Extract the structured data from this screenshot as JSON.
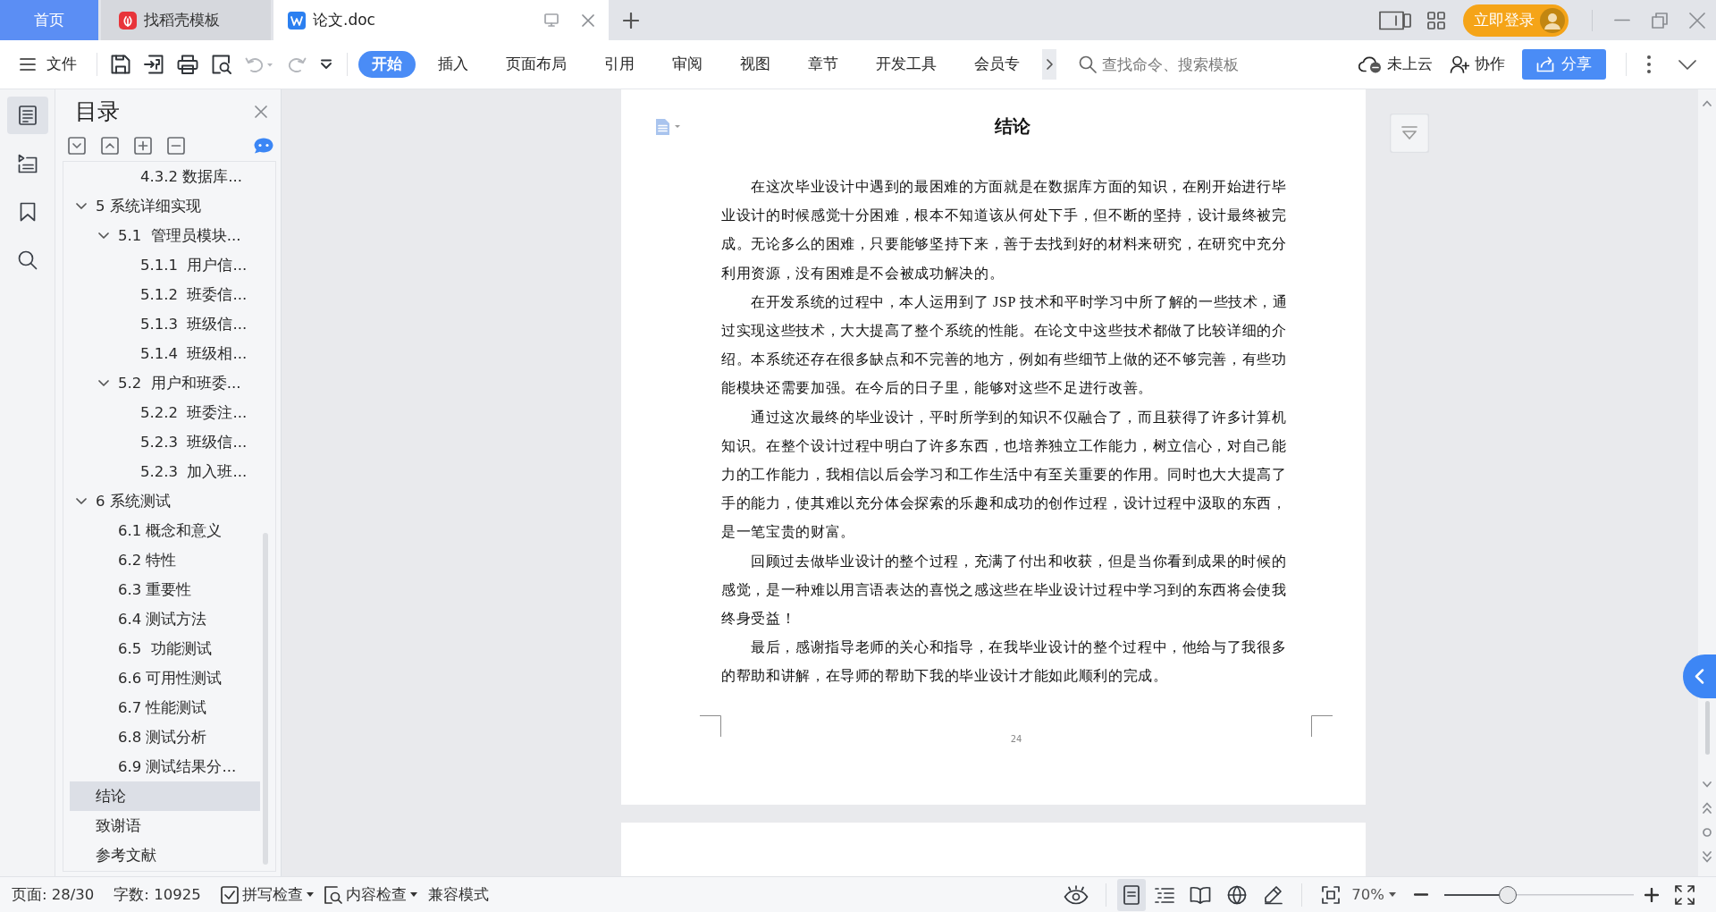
{
  "title_bar": {
    "tabs": [
      {
        "kind": "home",
        "label": "首页",
        "selected": false
      },
      {
        "kind": "template",
        "label": "找稻壳模板",
        "selected": false
      },
      {
        "kind": "document",
        "label": "论文.doc",
        "selected": true
      }
    ],
    "login_button": "立即登录"
  },
  "ribbon": {
    "file_menu": "文件",
    "quick_access": [
      {
        "kind": "save",
        "disabled": false
      },
      {
        "kind": "export",
        "disabled": false
      },
      {
        "kind": "print",
        "disabled": false
      },
      {
        "kind": "preview",
        "disabled": false
      },
      {
        "kind": "undo",
        "disabled": true
      },
      {
        "kind": "redo",
        "disabled": true
      },
      {
        "kind": "customize",
        "disabled": false
      }
    ],
    "tabs": [
      {
        "label": "开始",
        "selected": true
      },
      {
        "label": "插入",
        "selected": false
      },
      {
        "label": "页面布局",
        "selected": false
      },
      {
        "label": "引用",
        "selected": false
      },
      {
        "label": "审阅",
        "selected": false
      },
      {
        "label": "视图",
        "selected": false
      },
      {
        "label": "章节",
        "selected": false
      },
      {
        "label": "开发工具",
        "selected": false
      },
      {
        "label": "会员专",
        "selected": false
      }
    ],
    "search": {
      "placeholder": "查找命令、搜索模板"
    },
    "cloud_status": "未上云",
    "collaborate": "协作",
    "share": "分享"
  },
  "side_rail": [
    {
      "kind": "outline",
      "selected": true
    },
    {
      "kind": "navigation",
      "selected": false
    },
    {
      "kind": "bookmark",
      "selected": false
    },
    {
      "kind": "search",
      "selected": false
    }
  ],
  "sidebar": {
    "title": "目录",
    "clipped_item": {
      "label": "4.3.2 数据库...",
      "selected": false
    },
    "outline": [
      {
        "label": "5 系统详细实现",
        "expanded": true,
        "selected": false,
        "children": [
          {
            "label": "5.1  管理员模块...",
            "expanded": true,
            "selected": false,
            "children": [
              {
                "label": "5.1.1  用户信...",
                "selected": false
              },
              {
                "label": "5.1.2  班委信...",
                "selected": false
              },
              {
                "label": "5.1.3  班级信...",
                "selected": false
              },
              {
                "label": "5.1.4  班级相...",
                "selected": false
              }
            ]
          },
          {
            "label": "5.2  用户和班委...",
            "expanded": true,
            "selected": false,
            "children": [
              {
                "label": "5.2.2  班委注...",
                "selected": false
              },
              {
                "label": "5.2.3  班级信...",
                "selected": false
              },
              {
                "label": "5.2.3  加入班...",
                "selected": false
              }
            ]
          }
        ]
      },
      {
        "label": "6 系统测试",
        "expanded": true,
        "selected": false,
        "children": [
          {
            "label": "6.1 概念和意义",
            "selected": false
          },
          {
            "label": "6.2 特性",
            "selected": false
          },
          {
            "label": "6.3 重要性",
            "selected": false
          },
          {
            "label": "6.4 测试方法",
            "selected": false
          },
          {
            "label": "6.5  功能测试",
            "selected": false
          },
          {
            "label": "6.6 可用性测试",
            "selected": false
          },
          {
            "label": "6.7 性能测试",
            "selected": false
          },
          {
            "label": "6.8 测试分析",
            "selected": false
          },
          {
            "label": "6.9 测试结果分...",
            "selected": false
          }
        ]
      },
      {
        "label": "结论",
        "selected": true
      },
      {
        "label": "致谢语",
        "selected": false
      },
      {
        "label": "参考文献",
        "selected": false
      }
    ]
  },
  "document": {
    "heading": "结论",
    "paragraphs": [
      "在这次毕业设计中遇到的最困难的方面就是在数据库方面的知识，在刚开始进行毕业设计的时候感觉十分困难，根本不知道该从何处下手，但不断的坚持，设计最终被完成。无论多么的困难，只要能够坚持下来，善于去找到好的材料来研究，在研究中充分利用资源，没有困难是不会被成功解决的。",
      "在开发系统的过程中，本人运用到了 JSP 技术和平时学习中所了解的一些技术，通过实现这些技术，大大提高了整个系统的性能。在论文中这些技术都做了比较详细的介绍。本系统还存在很多缺点和不完善的地方，例如有些细节上做的还不够完善，有些功能模块还需要加强。在今后的日子里，能够对这些不足进行改善。",
      "通过这次最终的毕业设计，平时所学到的知识不仅融合了，而且获得了许多计算机知识。在整个设计过程中明白了许多东西，也培养独立工作能力，树立信心，对自己能力的工作能力，我相信以后会学习和工作生活中有至关重要的作用。同时也大大提高了手的能力，使其难以充分体会探索的乐趣和成功的创作过程，设计过程中汲取的东西，是一笔宝贵的财富。",
      "回顾过去做毕业设计的整个过程，充满了付出和收获，但是当你看到成果的时候的感觉，是一种难以用言语表达的喜悦之感这些在毕业设计过程中学习到的东西将会使我终身受益！",
      "最后，感谢指导老师的关心和指导，在我毕业设计的整个过程中，他给与了我很多的帮助和讲解，在导师的帮助下我的毕业设计才能如此顺利的完成。"
    ],
    "page_number": "24"
  },
  "status_bar": {
    "page": "页面: 28/30",
    "word_count": "字数: 10925",
    "spell_check": "拼写检查",
    "content_check": "内容检查",
    "compat_mode": "兼容模式",
    "view_modes": [
      {
        "kind": "eye-care",
        "selected": false
      },
      {
        "kind": "page",
        "selected": true
      },
      {
        "kind": "outline",
        "selected": false
      },
      {
        "kind": "reading",
        "selected": false
      },
      {
        "kind": "web",
        "selected": false
      },
      {
        "kind": "pen",
        "selected": false
      }
    ],
    "zoom": "70%",
    "zoom_slider": {
      "level": 0.32
    }
  }
}
